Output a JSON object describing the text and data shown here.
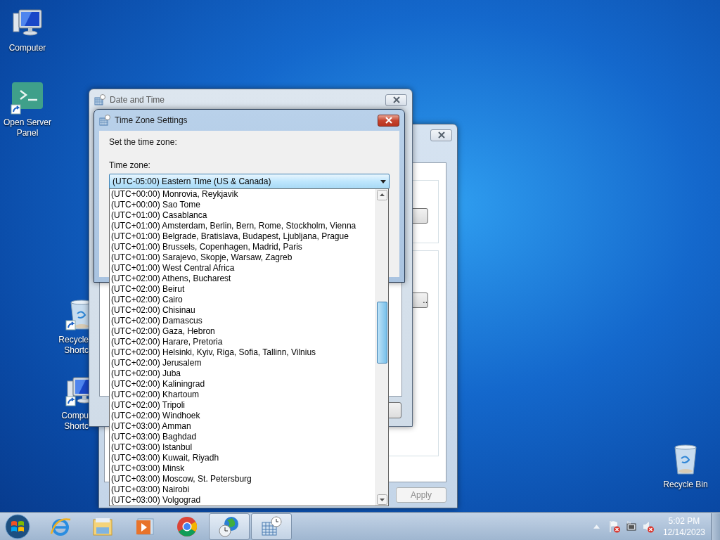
{
  "desktop_icons": [
    {
      "kind": "computer",
      "lines": [
        "Computer"
      ]
    },
    {
      "kind": "server-panel",
      "lines": [
        "Open Server",
        "Panel"
      ]
    },
    {
      "kind": "recycle-shortcut",
      "lines": [
        "Recycle",
        "Shortc"
      ]
    },
    {
      "kind": "computer-shortcut",
      "lines": [
        "Compu",
        "Shortc"
      ]
    },
    {
      "kind": "recycle-bin",
      "lines": [
        "Recycle Bin"
      ]
    }
  ],
  "back_window": {
    "browse_button": "..",
    "apply_button": {
      "label": "Apply",
      "disabled": true
    }
  },
  "date_time_window": {
    "title": "Date and Time"
  },
  "time_zone_dialog": {
    "title": "Time Zone Settings",
    "prompt": "Set the time zone:",
    "field_label": "Time zone:",
    "value": "(UTC-05:00) Eastern Time (US & Canada)",
    "options": [
      {
        "label": "(UTC+00:00) Monrovia, Reykjavik",
        "selected": false
      },
      {
        "label": "(UTC+00:00) Sao Tome",
        "selected": false
      },
      {
        "label": "(UTC+01:00) Casablanca",
        "selected": false
      },
      {
        "label": "(UTC+01:00) Amsterdam, Berlin, Bern, Rome, Stockholm, Vienna",
        "selected": false
      },
      {
        "label": "(UTC+01:00) Belgrade, Bratislava, Budapest, Ljubljana, Prague",
        "selected": false
      },
      {
        "label": "(UTC+01:00) Brussels, Copenhagen, Madrid, Paris",
        "selected": false
      },
      {
        "label": "(UTC+01:00) Sarajevo, Skopje, Warsaw, Zagreb",
        "selected": false
      },
      {
        "label": "(UTC+01:00) West Central Africa",
        "selected": false
      },
      {
        "label": "(UTC+02:00) Athens, Bucharest",
        "selected": false
      },
      {
        "label": "(UTC+02:00) Beirut",
        "selected": false
      },
      {
        "label": "(UTC+02:00) Cairo",
        "selected": false
      },
      {
        "label": "(UTC+02:00) Chisinau",
        "selected": false
      },
      {
        "label": "(UTC+02:00) Damascus",
        "selected": false
      },
      {
        "label": "(UTC+02:00) Gaza, Hebron",
        "selected": false
      },
      {
        "label": "(UTC+02:00) Harare, Pretoria",
        "selected": false
      },
      {
        "label": "(UTC+02:00) Helsinki, Kyiv, Riga, Sofia, Tallinn, Vilnius",
        "selected": false
      },
      {
        "label": "(UTC+02:00) Jerusalem",
        "selected": false
      },
      {
        "label": "(UTC+02:00) Juba",
        "selected": false
      },
      {
        "label": "(UTC+02:00) Kaliningrad",
        "selected": false
      },
      {
        "label": "(UTC+02:00) Khartoum",
        "selected": false
      },
      {
        "label": "(UTC+02:00) Tripoli",
        "selected": false
      },
      {
        "label": "(UTC+02:00) Windhoek",
        "selected": false
      },
      {
        "label": "(UTC+03:00) Amman",
        "selected": false
      },
      {
        "label": "(UTC+03:00) Baghdad",
        "selected": false
      },
      {
        "label": "(UTC+03:00) Istanbul",
        "selected": false
      },
      {
        "label": "(UTC+03:00) Kuwait, Riyadh",
        "selected": false
      },
      {
        "label": "(UTC+03:00) Minsk",
        "selected": false
      },
      {
        "label": "(UTC+03:00) Moscow, St. Petersburg",
        "selected": false
      },
      {
        "label": "(UTC+03:00) Nairobi",
        "selected": false
      },
      {
        "label": "(UTC+03:00) Volgograd",
        "selected": false
      }
    ]
  },
  "taskbar": {
    "items": [
      {
        "kind": "browser",
        "active": false
      },
      {
        "kind": "folders",
        "active": false
      },
      {
        "kind": "media-player",
        "active": false
      },
      {
        "kind": "chrome",
        "active": false
      },
      {
        "kind": "globe-clock",
        "active": true
      },
      {
        "kind": "calendar-clock",
        "active": true
      }
    ],
    "tray": [
      {
        "kind": "flag",
        "alert": true
      },
      {
        "kind": "network",
        "alert": false
      },
      {
        "kind": "speaker",
        "alert": true
      }
    ],
    "time": "5:02 PM",
    "date": "12/14/2023"
  }
}
